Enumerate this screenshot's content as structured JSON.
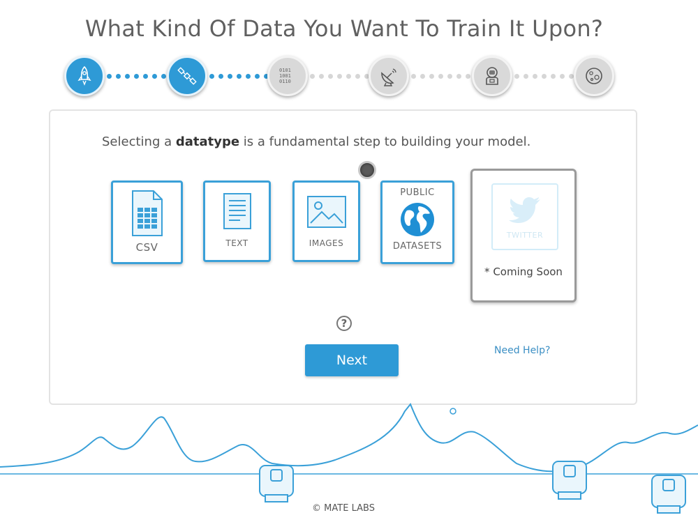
{
  "page": {
    "title": "What Kind Of Data You Want To Train It Upon?"
  },
  "stepper": {
    "steps": [
      {
        "icon": "rocket-icon",
        "state": "active"
      },
      {
        "icon": "satellite-icon",
        "state": "active"
      },
      {
        "icon": "binary-data-icon",
        "state": "inactive"
      },
      {
        "icon": "satellite-dish-icon",
        "state": "inactive"
      },
      {
        "icon": "astronaut-icon",
        "state": "inactive"
      },
      {
        "icon": "moon-icon",
        "state": "inactive"
      }
    ],
    "completed_connectors": 2,
    "total_connectors": 5
  },
  "panel": {
    "intro_before": "Selecting a ",
    "intro_bold": "datatype",
    "intro_after": " is a fundamental step to building your model.",
    "cards": {
      "csv": {
        "label": "CSV",
        "icon": "spreadsheet-file-icon"
      },
      "text": {
        "label": "TEXT",
        "icon": "text-document-icon"
      },
      "images": {
        "label": "IMAGES",
        "icon": "image-icon"
      },
      "public": {
        "label_top": "PUBLIC",
        "label_bottom": "DATASETS",
        "icon": "globe-icon"
      },
      "twitter": {
        "label": "TWITTER",
        "note": "* Coming Soon",
        "icon": "twitter-bird-icon",
        "disabled": true
      }
    },
    "help_symbol": "?",
    "next_label": "Next",
    "need_help_label": "Need Help?"
  },
  "footer": {
    "copyright": "© MATE LABS"
  },
  "colors": {
    "accent": "#2e9ad6",
    "inactive_step": "#d9d9d9",
    "disabled_border": "#9a9a9a"
  }
}
